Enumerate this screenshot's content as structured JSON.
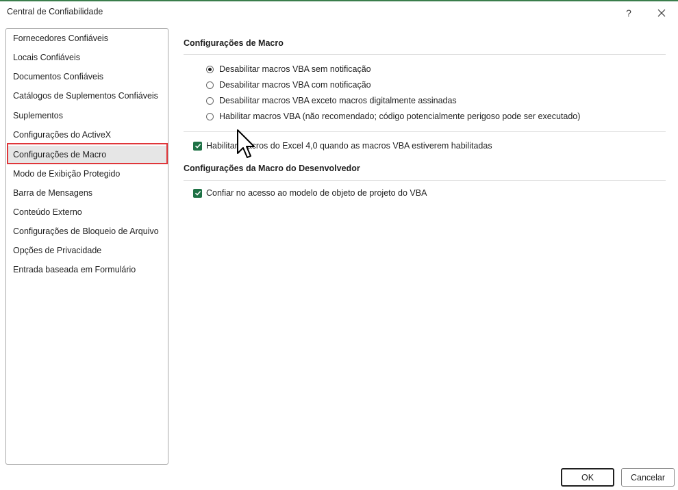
{
  "window": {
    "title": "Central de Confiabilidade",
    "help_label": "?"
  },
  "sidebar": {
    "items": [
      {
        "label": "Fornecedores Confiáveis"
      },
      {
        "label": "Locais Confiáveis"
      },
      {
        "label": "Documentos Confiáveis"
      },
      {
        "label": "Catálogos de Suplementos Confiáveis"
      },
      {
        "label": "Suplementos"
      },
      {
        "label": "Configurações do ActiveX"
      },
      {
        "label": "Configurações de Macro"
      },
      {
        "label": "Modo de Exibição Protegido"
      },
      {
        "label": "Barra de Mensagens"
      },
      {
        "label": "Conteúdo Externo"
      },
      {
        "label": "Configurações de Bloqueio de Arquivo"
      },
      {
        "label": "Opções de Privacidade"
      },
      {
        "label": "Entrada baseada em Formulário"
      }
    ],
    "selected_index": 6
  },
  "macro_settings": {
    "title": "Configurações de Macro",
    "options": [
      {
        "label": "Desabilitar macros VBA sem notificação",
        "checked": true
      },
      {
        "label": "Desabilitar macros VBA com notificação",
        "checked": false
      },
      {
        "label": "Desabilitar macros VBA exceto macros digitalmente assinadas",
        "checked": false
      },
      {
        "label": "Habilitar macros VBA (não recomendado; código potencialmente perigoso pode ser executado)",
        "checked": false
      }
    ],
    "excel4_label": "Habilitar macros do Excel 4,0 quando as macros VBA estiverem habilitadas",
    "excel4_checked": true
  },
  "developer_settings": {
    "title": "Configurações da Macro do Desenvolvedor",
    "vba_trust_label": "Confiar no acesso ao modelo de objeto de projeto do VBA",
    "vba_trust_checked": true
  },
  "footer": {
    "ok_label": "OK",
    "cancel_label": "Cancelar"
  },
  "colors": {
    "checkbox": "#1e7145",
    "selection_frame": "#e0363a",
    "selected_bg": "#e6e6e6"
  }
}
